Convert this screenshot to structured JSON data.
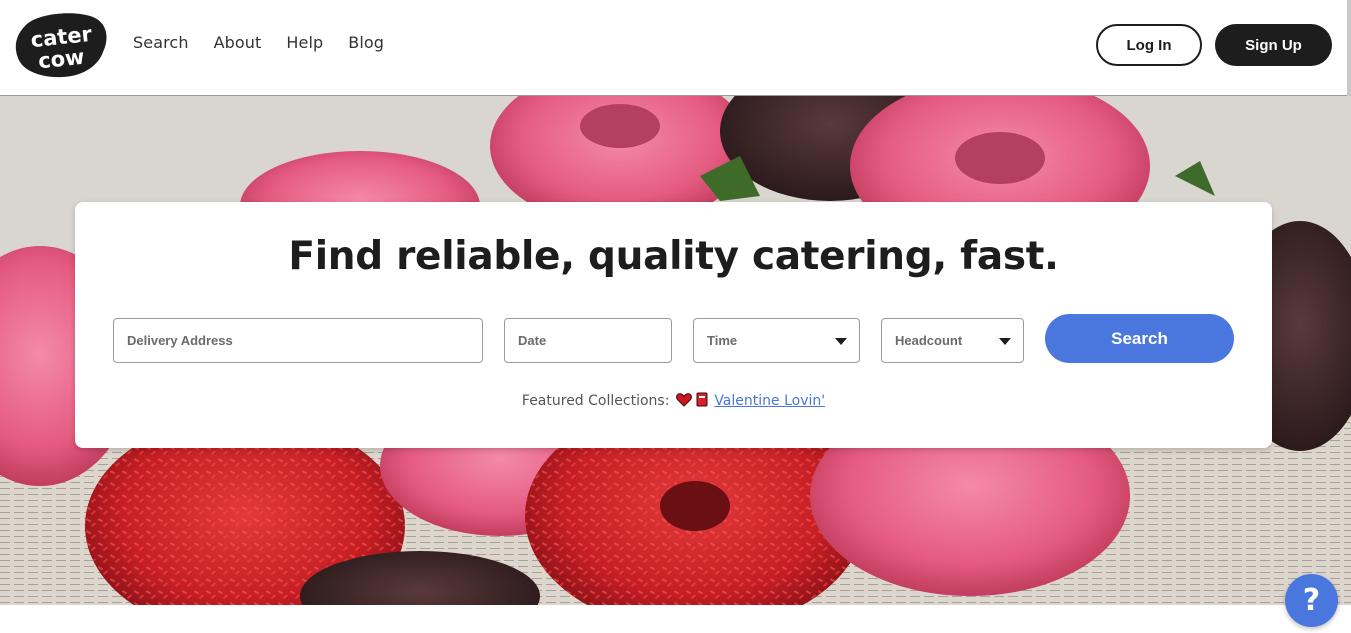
{
  "brand": {
    "logo_text_line1": "cater",
    "logo_text_line2": "cow"
  },
  "nav": {
    "items": [
      "Search",
      "About",
      "Help",
      "Blog"
    ]
  },
  "auth": {
    "login_label": "Log In",
    "signup_label": "Sign Up"
  },
  "hero": {
    "headline": "Find reliable, quality catering, fast.",
    "fields": {
      "address_placeholder": "Delivery Address",
      "date_placeholder": "Date",
      "time_placeholder": "Time",
      "headcount_placeholder": "Headcount"
    },
    "search_label": "Search",
    "featured_label": "Featured Collections:",
    "featured_link": "Valentine Lovin'",
    "featured_icons": [
      "heart-icon",
      "cup-icon"
    ]
  },
  "help_button": {
    "label": "?"
  },
  "colors": {
    "accent": "#4a77de",
    "dark": "#1d1d1d"
  }
}
